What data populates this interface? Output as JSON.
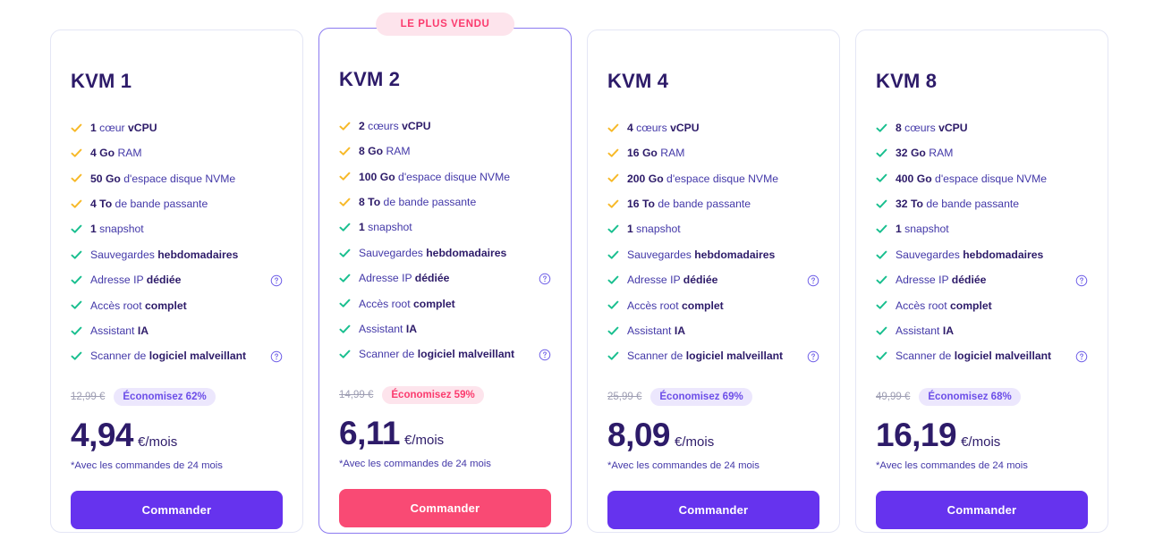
{
  "accents": {
    "purple": "#6633ee",
    "pink": "#f94a74",
    "badge_pink_bg": "#fde4ec",
    "badge_purple_bg": "#ece7fd",
    "check_yellow": "#f7b928",
    "check_green": "#19bf8f",
    "title_navy": "#2d1b69",
    "text_indigo": "#4338a8",
    "old_price_gray": "#9e9eb3",
    "card_border": "#e4e6f5",
    "featured_border": "#8b7af0"
  },
  "labels": {
    "order_button": "Commander",
    "price_unit": "€/mois",
    "best_seller_badge": "LE PLUS VENDU",
    "price_note": "*Avec les commandes de 24 mois"
  },
  "plans": [
    {
      "name": "KVM 1",
      "featured": false,
      "old_price": "12,99 €",
      "save_badge": "Économisez 62%",
      "price": "4,94",
      "price_unit": "€/mois",
      "note": "*Avec les commandes de 24 mois",
      "button": "Commander",
      "features": [
        {
          "bold": "1 cœur ",
          "rest": "vCPU",
          "bold_first": false,
          "lead": "1",
          "color": "yellow",
          "help": false,
          "text_html": "1 cœur vCPU"
        },
        {
          "color": "yellow",
          "help": false,
          "text_html": "4 Go RAM"
        },
        {
          "color": "yellow",
          "help": false,
          "text_html": "50 Go d'espace disque NVMe"
        },
        {
          "color": "yellow",
          "help": false,
          "text_html": "4 To de bande passante"
        },
        {
          "color": "green",
          "help": false,
          "text_html": "1 snapshot"
        },
        {
          "color": "green",
          "help": false,
          "text_html": "Sauvegardes hebdomadaires"
        },
        {
          "color": "green",
          "help": true,
          "text_html": "Adresse IP dédiée"
        },
        {
          "color": "green",
          "help": false,
          "text_html": "Accès root complet"
        },
        {
          "color": "green",
          "help": false,
          "text_html": "Assistant IA"
        },
        {
          "color": "green",
          "help": true,
          "text_html": "Scanner de logiciel malveillant"
        }
      ]
    },
    {
      "name": "KVM 2",
      "featured": true,
      "badge": "LE PLUS VENDU",
      "old_price": "14,99 €",
      "save_badge": "Économisez 59%",
      "price": "6,11",
      "price_unit": "€/mois",
      "note": "*Avec les commandes de 24 mois",
      "button": "Commander",
      "features": [
        {
          "color": "yellow",
          "help": false,
          "text_html": "2 cœurs vCPU"
        },
        {
          "color": "yellow",
          "help": false,
          "text_html": "8 Go RAM"
        },
        {
          "color": "yellow",
          "help": false,
          "text_html": "100 Go d'espace disque NVMe"
        },
        {
          "color": "yellow",
          "help": false,
          "text_html": "8 To de bande passante"
        },
        {
          "color": "green",
          "help": false,
          "text_html": "1 snapshot"
        },
        {
          "color": "green",
          "help": false,
          "text_html": "Sauvegardes hebdomadaires"
        },
        {
          "color": "green",
          "help": true,
          "text_html": "Adresse IP dédiée"
        },
        {
          "color": "green",
          "help": false,
          "text_html": "Accès root complet"
        },
        {
          "color": "green",
          "help": false,
          "text_html": "Assistant IA"
        },
        {
          "color": "green",
          "help": true,
          "text_html": "Scanner de logiciel malveillant"
        }
      ]
    },
    {
      "name": "KVM 4",
      "featured": false,
      "old_price": "25,99 €",
      "save_badge": "Économisez 69%",
      "price": "8,09",
      "price_unit": "€/mois",
      "note": "*Avec les commandes de 24 mois",
      "button": "Commander",
      "features": [
        {
          "color": "yellow",
          "help": false,
          "text_html": "4 cœurs vCPU"
        },
        {
          "color": "yellow",
          "help": false,
          "text_html": "16 Go RAM"
        },
        {
          "color": "yellow",
          "help": false,
          "text_html": "200 Go d'espace disque NVMe"
        },
        {
          "color": "yellow",
          "help": false,
          "text_html": "16 To de bande passante"
        },
        {
          "color": "green",
          "help": false,
          "text_html": "1 snapshot"
        },
        {
          "color": "green",
          "help": false,
          "text_html": "Sauvegardes hebdomadaires"
        },
        {
          "color": "green",
          "help": true,
          "text_html": "Adresse IP dédiée"
        },
        {
          "color": "green",
          "help": false,
          "text_html": "Accès root complet"
        },
        {
          "color": "green",
          "help": false,
          "text_html": "Assistant IA"
        },
        {
          "color": "green",
          "help": true,
          "text_html": "Scanner de logiciel malveillant"
        }
      ]
    },
    {
      "name": "KVM 8",
      "featured": false,
      "old_price": "49,99 €",
      "save_badge": "Économisez 68%",
      "price": "16,19",
      "price_unit": "€/mois",
      "note": "*Avec les commandes de 24 mois",
      "button": "Commander",
      "features": [
        {
          "color": "green",
          "help": false,
          "text_html": "8 cœurs vCPU"
        },
        {
          "color": "green",
          "help": false,
          "text_html": "32 Go RAM"
        },
        {
          "color": "green",
          "help": false,
          "text_html": "400 Go d'espace disque NVMe"
        },
        {
          "color": "green",
          "help": false,
          "text_html": "32 To de bande passante"
        },
        {
          "color": "green",
          "help": false,
          "text_html": "1 snapshot"
        },
        {
          "color": "green",
          "help": false,
          "text_html": "Sauvegardes hebdomadaires"
        },
        {
          "color": "green",
          "help": true,
          "text_html": "Adresse IP dédiée"
        },
        {
          "color": "green",
          "help": false,
          "text_html": "Accès root complet"
        },
        {
          "color": "green",
          "help": false,
          "text_html": "Assistant IA"
        },
        {
          "color": "green",
          "help": true,
          "text_html": "Scanner de logiciel malveillant"
        }
      ]
    }
  ],
  "feature_bold_prefix": {
    "1 cœur vCPU": "vCPU",
    "2 cœurs vCPU": "vCPU",
    "4 cœurs vCPU": "vCPU",
    "8 cœurs vCPU": "vCPU"
  },
  "icons": {
    "check": "check-icon",
    "help": "help-circle-icon"
  }
}
